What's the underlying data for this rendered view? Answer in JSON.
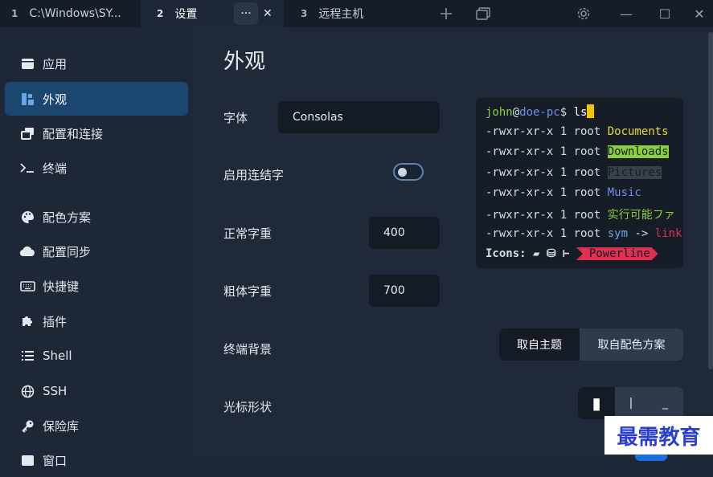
{
  "tabs": [
    {
      "num": "1",
      "label": "C:\\Windows\\SY..."
    },
    {
      "num": "2",
      "label": "设置"
    },
    {
      "num": "3",
      "label": "远程主机"
    }
  ],
  "tab_menu_label": "···",
  "tab_close_label": "✕",
  "window_controls": {
    "minimize": "—",
    "maximize": "☐",
    "close": "✕"
  },
  "sidebar": {
    "items": [
      {
        "label": "应用",
        "icon": "window-icon"
      },
      {
        "label": "外观",
        "icon": "palette-grid-icon"
      },
      {
        "label": "配置和连接",
        "icon": "windows-stack-icon"
      },
      {
        "label": "终端",
        "icon": "terminal-icon"
      },
      {
        "label": "配色方案",
        "icon": "paint-palette-icon"
      },
      {
        "label": "配置同步",
        "icon": "cloud-icon"
      },
      {
        "label": "快捷键",
        "icon": "keyboard-icon"
      },
      {
        "label": "插件",
        "icon": "puzzle-icon"
      },
      {
        "label": "Shell",
        "icon": "list-icon"
      },
      {
        "label": "SSH",
        "icon": "globe-icon"
      },
      {
        "label": "保险库",
        "icon": "key-icon"
      },
      {
        "label": "窗口",
        "icon": "window-icon"
      }
    ]
  },
  "page": {
    "title": "外观",
    "font_label": "字体",
    "font_value": "Consolas",
    "ligatures_label": "启用连结字",
    "ligatures_enabled": false,
    "normal_weight_label": "正常字重",
    "normal_weight_value": "400",
    "bold_weight_label": "粗体字重",
    "bold_weight_value": "700",
    "bg_label": "终端背景",
    "bg_options": [
      "取自主题",
      "取自配色方案"
    ],
    "cursor_label": "光标形状",
    "cursor_options": [
      "▮",
      "|",
      "_"
    ]
  },
  "preview": {
    "user": "john",
    "at": "@",
    "host": "doe-pc",
    "prompt": "$ ",
    "cmd": "ls",
    "perm": "-rwxr-xr-x 1 root ",
    "files": [
      "Documents",
      "Downloads",
      "Pictures",
      "Music",
      "实行可能ファ",
      "sym",
      " -> ",
      "link"
    ],
    "icons_label": "Icons:",
    "icons_glyphs": " ▰ ⛁ ⊢ ",
    "powerline": "Powerline"
  },
  "colors": {
    "accent": "#1b4670",
    "documents": "#e5d93a",
    "downloads_bg": "#8bcf3c",
    "music": "#6f8fe8",
    "exec": "#8bcf3c",
    "link": "#e0304f",
    "powerline_bg": "#e0304f",
    "cursor": "#f5c400"
  },
  "watermark": "最需教育"
}
